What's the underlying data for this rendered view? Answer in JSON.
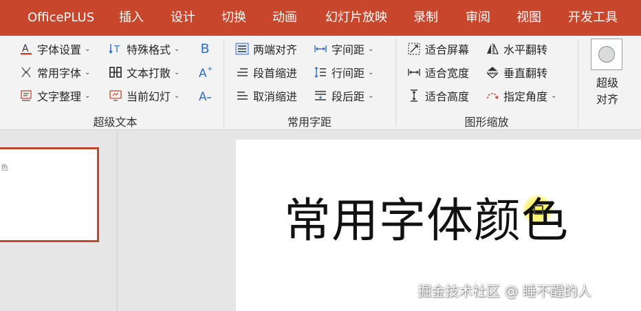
{
  "colors": {
    "accent": "#c8462b",
    "ribbon_bg": "#f3f3f3",
    "icon_blue": "#2f6ec1"
  },
  "tabs": [
    "OfficePLUS",
    "插入",
    "设计",
    "切换",
    "动画",
    "幻灯片放映",
    "录制",
    "审阅",
    "视图",
    "开发工具"
  ],
  "ribbon": {
    "group1": {
      "label": "超级文本",
      "buttons": [
        "字体设置",
        "特殊格式",
        "常用字体",
        "文本打散",
        "文字整理",
        "当前幻灯"
      ],
      "bold_icon": "B"
    },
    "group2": {
      "label": "常用字距",
      "buttons": [
        "两端对齐",
        "字间距",
        "段首缩进",
        "行间距",
        "取消缩进",
        "段后距"
      ]
    },
    "group3": {
      "label": "图形缩放",
      "buttons": [
        "适合屏幕",
        "水平翻转",
        "适合宽度",
        "垂直翻转",
        "适合高度",
        "指定角度"
      ]
    },
    "group4": {
      "label": "超级对齐"
    }
  },
  "thumbnail": {
    "text": "色"
  },
  "slide": {
    "title": "常用字体颜色"
  },
  "watermark": "掘金技术社区 @ 睡不醒的人"
}
